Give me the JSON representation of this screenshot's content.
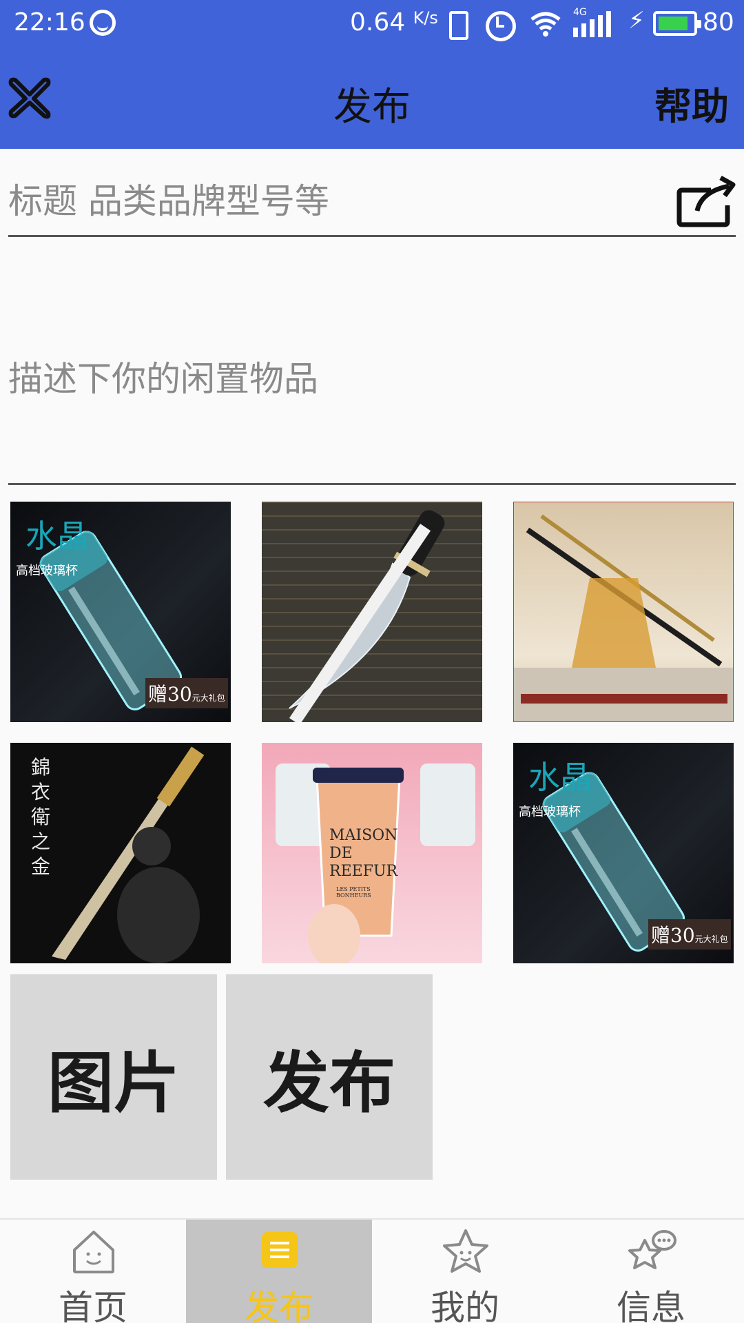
{
  "status_bar": {
    "time": "22:16",
    "network_speed": "0.64",
    "network_speed_unit": "K/s",
    "network_type": "4G",
    "battery_level": "80"
  },
  "app_bar": {
    "title": "发布",
    "help_label": "帮助"
  },
  "form": {
    "title_placeholder": "标题 品类品牌型号等",
    "title_value": "",
    "description_placeholder": "描述下你的闲置物品",
    "description_value": ""
  },
  "photos": {
    "items": [
      {
        "name": "crystal-glass-cup",
        "caption_big": "水晶",
        "caption_small": "高档玻璃杯",
        "badge": "赠30",
        "badge_suffix": "元大礼包"
      },
      {
        "name": "kukri-knife",
        "caption_big": "",
        "caption_small": "",
        "badge": "",
        "badge_suffix": ""
      },
      {
        "name": "sword-on-stand",
        "caption_big": "",
        "caption_small": "",
        "badge": "",
        "badge_suffix": ""
      },
      {
        "name": "saber-with-warrior",
        "caption_big": "錦衣衛之金",
        "caption_small": "",
        "badge": "",
        "badge_suffix": ""
      },
      {
        "name": "juice-cup",
        "caption_big": "MAISON DE REEFUR",
        "caption_small": "LES PETITS BONHEURS",
        "badge": "",
        "badge_suffix": ""
      },
      {
        "name": "crystal-glass-cup-2",
        "caption_big": "水晶",
        "caption_small": "高档玻璃杯",
        "badge": "赠30",
        "badge_suffix": "元大礼包"
      }
    ]
  },
  "actions": {
    "picture_label": "图片",
    "publish_label": "发布"
  },
  "bottom_nav": {
    "items": [
      {
        "label": "首页",
        "icon": "home-icon",
        "active": false
      },
      {
        "label": "发布",
        "icon": "publish-icon",
        "active": true
      },
      {
        "label": "我的",
        "icon": "profile-star-icon",
        "active": false
      },
      {
        "label": "信息",
        "icon": "message-icon",
        "active": false
      }
    ],
    "active_color": "#f5c518"
  },
  "colors": {
    "header": "#4163d9",
    "button_bg": "#d8d8d8",
    "nav_active_bg": "#c4c4c4"
  }
}
